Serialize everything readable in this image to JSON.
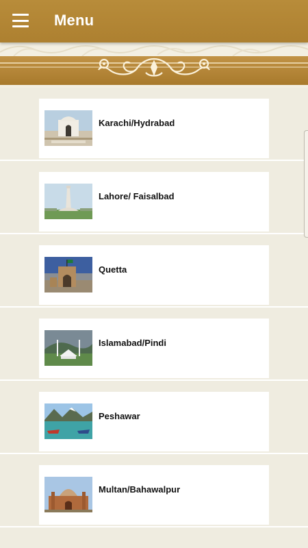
{
  "appbar": {
    "title": "Menu",
    "menu_icon": "hamburger-menu-icon",
    "color": "#b88c3a"
  },
  "banner": {
    "ornament": "ornamental-scroll-divider"
  },
  "cities": [
    {
      "label": "Karachi/Hydrabad",
      "image": "mazar-e-quaid-photo"
    },
    {
      "label": "Lahore/ Faisalbad",
      "image": "minar-e-pakistan-photo"
    },
    {
      "label": "Quetta",
      "image": "quetta-fort-gate-photo"
    },
    {
      "label": "Islamabad/Pindi",
      "image": "faisal-mosque-photo"
    },
    {
      "label": "Peshawar",
      "image": "mountain-lake-boats-photo"
    },
    {
      "label": "Multan/Bahawalpur",
      "image": "multan-shrine-photo"
    }
  ]
}
